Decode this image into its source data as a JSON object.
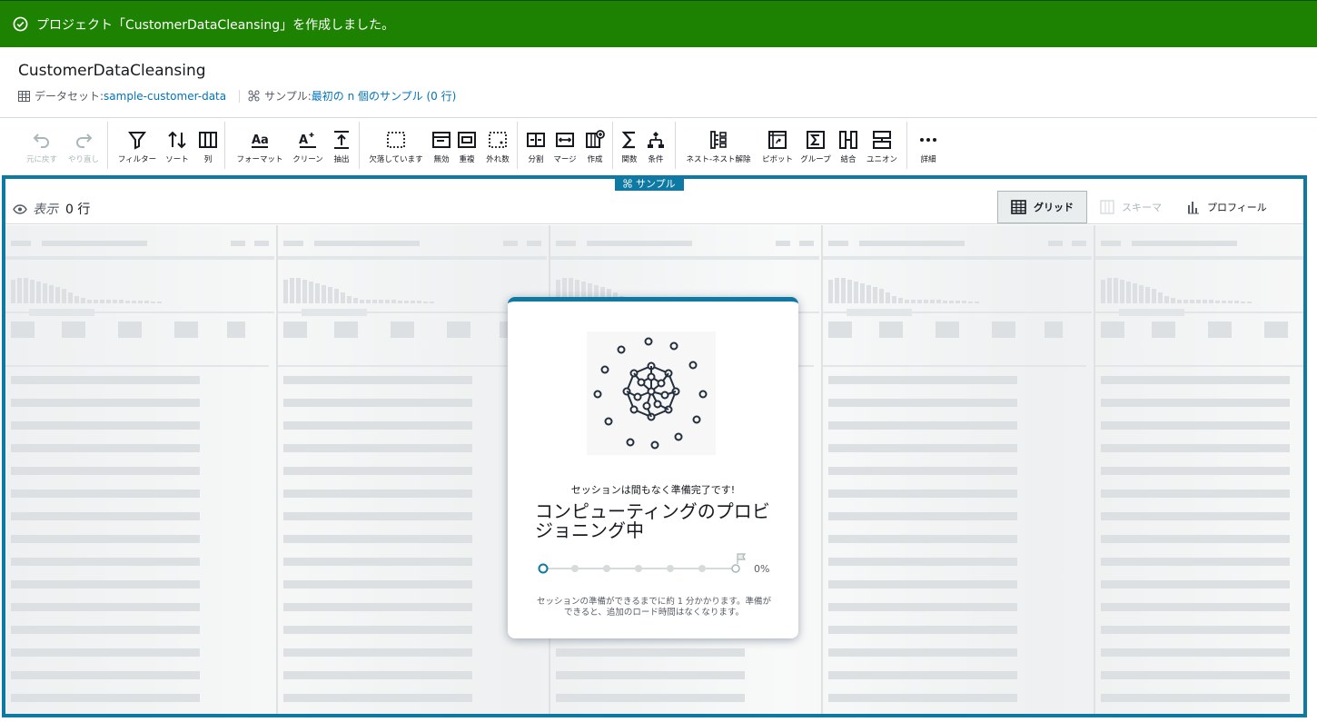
{
  "flash": {
    "message": "プロジェクト「CustomerDataCleansing」を作成しました。"
  },
  "header": {
    "title": "CustomerDataCleansing",
    "dataset_label": "データセット: ",
    "dataset_link": "sample-customer-data",
    "sample_label": "サンプル: ",
    "sample_link": "最初の n 個のサンプル (0 行)"
  },
  "toolbar": {
    "undo": "元に戻す",
    "redo": "やり直し",
    "filter": "フィルター",
    "sort": "ソート",
    "column": "列",
    "format": "フォーマット",
    "clean": "クリーン",
    "extract": "抽出",
    "missing": "欠落しています",
    "invalid": "無効",
    "duplicate": "重複",
    "outlier": "外れ数",
    "split": "分割",
    "merge": "マージ",
    "create": "作成",
    "function": "関数",
    "condition": "条件",
    "nest": "ネスト-ネスト解除",
    "pivot": "ピボット",
    "group": "グループ",
    "join": "結合",
    "union": "ユニオン",
    "more": "詳細"
  },
  "sample_tab": "サンプル",
  "viewbar": {
    "show_label": "表示",
    "row_count": "0 行",
    "tabs": [
      "グリッド",
      "スキーマ",
      "プロフィール"
    ]
  },
  "session": {
    "subtitle": "セッションは間もなく準備完了です!",
    "heading": "コンピューティングのプロビジョニング中",
    "progress_percent": "0%",
    "progress_value": 0,
    "note": "セッションの準備ができるまでに約 1 分かかります。準備ができると、追加のロード時間はなくなります。"
  },
  "colors": {
    "accent": "#0e7aa3",
    "success": "#1d8102",
    "link": "#0073bb"
  }
}
